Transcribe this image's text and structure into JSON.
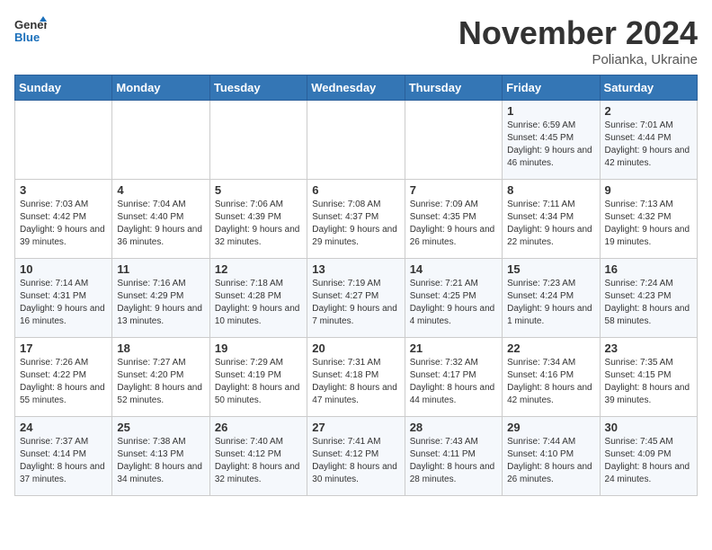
{
  "header": {
    "logo_general": "General",
    "logo_blue": "Blue",
    "month_title": "November 2024",
    "location": "Polianka, Ukraine"
  },
  "days_of_week": [
    "Sunday",
    "Monday",
    "Tuesday",
    "Wednesday",
    "Thursday",
    "Friday",
    "Saturday"
  ],
  "weeks": [
    [
      {
        "day": "",
        "info": ""
      },
      {
        "day": "",
        "info": ""
      },
      {
        "day": "",
        "info": ""
      },
      {
        "day": "",
        "info": ""
      },
      {
        "day": "",
        "info": ""
      },
      {
        "day": "1",
        "info": "Sunrise: 6:59 AM\nSunset: 4:45 PM\nDaylight: 9 hours and 46 minutes."
      },
      {
        "day": "2",
        "info": "Sunrise: 7:01 AM\nSunset: 4:44 PM\nDaylight: 9 hours and 42 minutes."
      }
    ],
    [
      {
        "day": "3",
        "info": "Sunrise: 7:03 AM\nSunset: 4:42 PM\nDaylight: 9 hours and 39 minutes."
      },
      {
        "day": "4",
        "info": "Sunrise: 7:04 AM\nSunset: 4:40 PM\nDaylight: 9 hours and 36 minutes."
      },
      {
        "day": "5",
        "info": "Sunrise: 7:06 AM\nSunset: 4:39 PM\nDaylight: 9 hours and 32 minutes."
      },
      {
        "day": "6",
        "info": "Sunrise: 7:08 AM\nSunset: 4:37 PM\nDaylight: 9 hours and 29 minutes."
      },
      {
        "day": "7",
        "info": "Sunrise: 7:09 AM\nSunset: 4:35 PM\nDaylight: 9 hours and 26 minutes."
      },
      {
        "day": "8",
        "info": "Sunrise: 7:11 AM\nSunset: 4:34 PM\nDaylight: 9 hours and 22 minutes."
      },
      {
        "day": "9",
        "info": "Sunrise: 7:13 AM\nSunset: 4:32 PM\nDaylight: 9 hours and 19 minutes."
      }
    ],
    [
      {
        "day": "10",
        "info": "Sunrise: 7:14 AM\nSunset: 4:31 PM\nDaylight: 9 hours and 16 minutes."
      },
      {
        "day": "11",
        "info": "Sunrise: 7:16 AM\nSunset: 4:29 PM\nDaylight: 9 hours and 13 minutes."
      },
      {
        "day": "12",
        "info": "Sunrise: 7:18 AM\nSunset: 4:28 PM\nDaylight: 9 hours and 10 minutes."
      },
      {
        "day": "13",
        "info": "Sunrise: 7:19 AM\nSunset: 4:27 PM\nDaylight: 9 hours and 7 minutes."
      },
      {
        "day": "14",
        "info": "Sunrise: 7:21 AM\nSunset: 4:25 PM\nDaylight: 9 hours and 4 minutes."
      },
      {
        "day": "15",
        "info": "Sunrise: 7:23 AM\nSunset: 4:24 PM\nDaylight: 9 hours and 1 minute."
      },
      {
        "day": "16",
        "info": "Sunrise: 7:24 AM\nSunset: 4:23 PM\nDaylight: 8 hours and 58 minutes."
      }
    ],
    [
      {
        "day": "17",
        "info": "Sunrise: 7:26 AM\nSunset: 4:22 PM\nDaylight: 8 hours and 55 minutes."
      },
      {
        "day": "18",
        "info": "Sunrise: 7:27 AM\nSunset: 4:20 PM\nDaylight: 8 hours and 52 minutes."
      },
      {
        "day": "19",
        "info": "Sunrise: 7:29 AM\nSunset: 4:19 PM\nDaylight: 8 hours and 50 minutes."
      },
      {
        "day": "20",
        "info": "Sunrise: 7:31 AM\nSunset: 4:18 PM\nDaylight: 8 hours and 47 minutes."
      },
      {
        "day": "21",
        "info": "Sunrise: 7:32 AM\nSunset: 4:17 PM\nDaylight: 8 hours and 44 minutes."
      },
      {
        "day": "22",
        "info": "Sunrise: 7:34 AM\nSunset: 4:16 PM\nDaylight: 8 hours and 42 minutes."
      },
      {
        "day": "23",
        "info": "Sunrise: 7:35 AM\nSunset: 4:15 PM\nDaylight: 8 hours and 39 minutes."
      }
    ],
    [
      {
        "day": "24",
        "info": "Sunrise: 7:37 AM\nSunset: 4:14 PM\nDaylight: 8 hours and 37 minutes."
      },
      {
        "day": "25",
        "info": "Sunrise: 7:38 AM\nSunset: 4:13 PM\nDaylight: 8 hours and 34 minutes."
      },
      {
        "day": "26",
        "info": "Sunrise: 7:40 AM\nSunset: 4:12 PM\nDaylight: 8 hours and 32 minutes."
      },
      {
        "day": "27",
        "info": "Sunrise: 7:41 AM\nSunset: 4:12 PM\nDaylight: 8 hours and 30 minutes."
      },
      {
        "day": "28",
        "info": "Sunrise: 7:43 AM\nSunset: 4:11 PM\nDaylight: 8 hours and 28 minutes."
      },
      {
        "day": "29",
        "info": "Sunrise: 7:44 AM\nSunset: 4:10 PM\nDaylight: 8 hours and 26 minutes."
      },
      {
        "day": "30",
        "info": "Sunrise: 7:45 AM\nSunset: 4:09 PM\nDaylight: 8 hours and 24 minutes."
      }
    ]
  ]
}
